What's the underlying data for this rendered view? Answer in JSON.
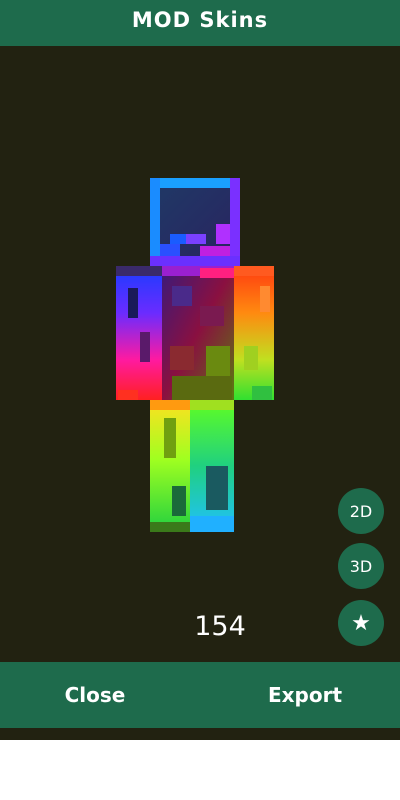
{
  "header": {
    "title": "MOD Skins"
  },
  "viewer": {
    "skin_preview": "rainbow-skin",
    "view_buttons": {
      "two_d": "2D",
      "three_d": "3D",
      "favorite": "★"
    },
    "counter": "154"
  },
  "footer": {
    "close_label": "Close",
    "export_label": "Export"
  },
  "colors": {
    "accent": "#1e6b4c",
    "background": "#222211"
  }
}
